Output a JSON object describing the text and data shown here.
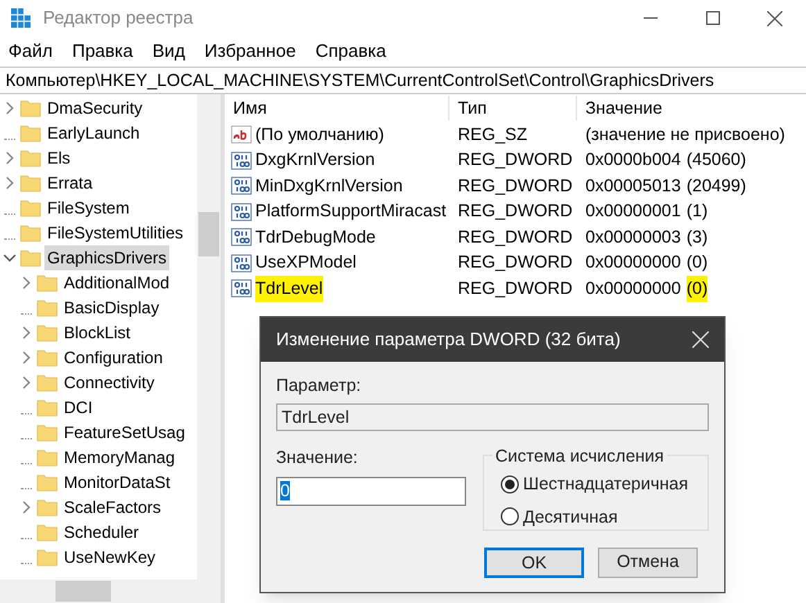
{
  "window": {
    "title": "Редактор реестра"
  },
  "menu": [
    "Файл",
    "Правка",
    "Вид",
    "Избранное",
    "Справка"
  ],
  "address": "Компьютер\\HKEY_LOCAL_MACHINE\\SYSTEM\\CurrentControlSet\\Control\\GraphicsDrivers",
  "tree": [
    {
      "label": "DmaSecurity",
      "expandable": true,
      "expanded": false,
      "selected": false
    },
    {
      "label": "EarlyLaunch",
      "expandable": false,
      "selected": false
    },
    {
      "label": "Els",
      "expandable": true,
      "expanded": false,
      "selected": false
    },
    {
      "label": "Errata",
      "expandable": true,
      "expanded": false,
      "selected": false
    },
    {
      "label": "FileSystem",
      "expandable": false,
      "selected": false
    },
    {
      "label": "FileSystemUtilities",
      "expandable": false,
      "selected": false
    },
    {
      "label": "GraphicsDrivers",
      "expandable": true,
      "expanded": true,
      "selected": true,
      "children": [
        {
          "label": "AdditionalMod",
          "expandable": true,
          "expanded": false,
          "selected": false
        },
        {
          "label": "BasicDisplay",
          "expandable": false,
          "selected": false
        },
        {
          "label": "BlockList",
          "expandable": true,
          "expanded": false,
          "selected": false
        },
        {
          "label": "Configuration",
          "expandable": true,
          "expanded": false,
          "selected": false
        },
        {
          "label": "Connectivity",
          "expandable": true,
          "expanded": false,
          "selected": false
        },
        {
          "label": "DCI",
          "expandable": false,
          "selected": false
        },
        {
          "label": "FeatureSetUsag",
          "expandable": false,
          "selected": false
        },
        {
          "label": "MemoryManag",
          "expandable": false,
          "selected": false
        },
        {
          "label": "MonitorDataSt",
          "expandable": false,
          "selected": false
        },
        {
          "label": "ScaleFactors",
          "expandable": true,
          "expanded": false,
          "selected": false
        },
        {
          "label": "Scheduler",
          "expandable": false,
          "selected": false
        },
        {
          "label": "UseNewKey",
          "expandable": false,
          "selected": false
        }
      ]
    }
  ],
  "table": {
    "columns": [
      "Имя",
      "Тип",
      "Значение"
    ],
    "rows": [
      {
        "kind": "string",
        "name": "(По умолчанию)",
        "type": "REG_SZ",
        "value": "(значение не присвоено)",
        "highlighted": false
      },
      {
        "kind": "dword",
        "name": "DxgKrnlVersion",
        "type": "REG_DWORD",
        "value": "0x0000b004",
        "decimal": "(45060)",
        "highlighted": false
      },
      {
        "kind": "dword",
        "name": "MinDxgKrnlVersion",
        "type": "REG_DWORD",
        "value": "0x00005013",
        "decimal": "(20499)",
        "highlighted": false
      },
      {
        "kind": "dword",
        "name": "PlatformSupportMiracast",
        "type": "REG_DWORD",
        "value": "0x00000001",
        "decimal": "(1)",
        "highlighted": false
      },
      {
        "kind": "dword",
        "name": "TdrDebugMode",
        "type": "REG_DWORD",
        "value": "0x00000003",
        "decimal": "(3)",
        "highlighted": false
      },
      {
        "kind": "dword",
        "name": "UseXPModel",
        "type": "REG_DWORD",
        "value": "0x00000000",
        "decimal": "(0)",
        "highlighted": false
      },
      {
        "kind": "dword",
        "name": "TdrLevel",
        "type": "REG_DWORD",
        "value": "0x00000000",
        "decimal": "(0)",
        "highlighted": true
      }
    ]
  },
  "dialog": {
    "title": "Изменение параметра DWORD (32 бита)",
    "parameter_label": "Параметр:",
    "parameter_value": "TdrLevel",
    "value_label": "Значение:",
    "value": "0",
    "base_group": "Система исчисления",
    "bases": [
      {
        "label": "Шестнадцатеричная",
        "selected": true
      },
      {
        "label": "Десятичная",
        "selected": false
      }
    ],
    "buttons": [
      {
        "label": "OK",
        "default": true
      },
      {
        "label": "Отмена",
        "default": false
      }
    ]
  }
}
